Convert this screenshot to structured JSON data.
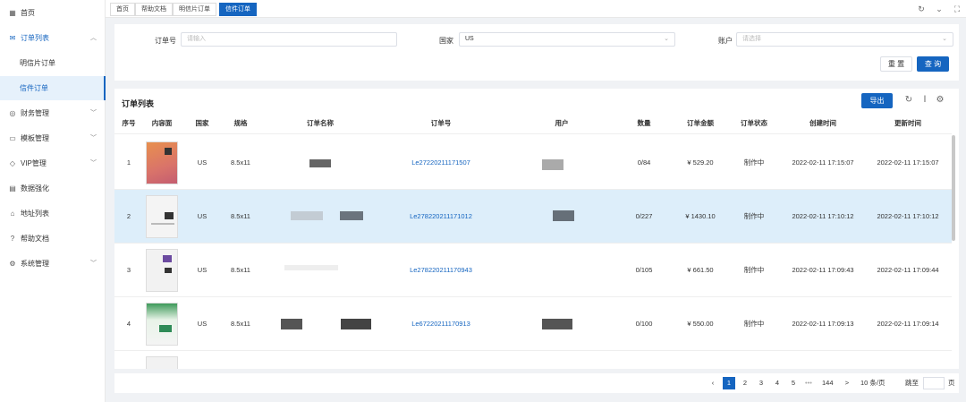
{
  "sidebar": {
    "items": [
      {
        "label": "首页",
        "icon": "grid-icon"
      },
      {
        "label": "订单列表",
        "icon": "mail-icon",
        "expanded": true
      },
      {
        "label": "明信片订单",
        "sub": true
      },
      {
        "label": "信件订单",
        "sub": true,
        "selected": true
      },
      {
        "label": "财务管理",
        "icon": "finance-icon",
        "expanded": false
      },
      {
        "label": "模板管理",
        "icon": "template-icon",
        "expanded": false
      },
      {
        "label": "VIP管理",
        "icon": "vip-icon",
        "expanded": false
      },
      {
        "label": "数据强化",
        "icon": "data-icon"
      },
      {
        "label": "地址列表",
        "icon": "address-icon"
      },
      {
        "label": "帮助文档",
        "icon": "help-icon"
      },
      {
        "label": "系统管理",
        "icon": "gear-icon",
        "expanded": false
      }
    ]
  },
  "tabs": [
    {
      "label": "首页"
    },
    {
      "label": "帮助文档"
    },
    {
      "label": "明信片订单"
    },
    {
      "label": "信件订单",
      "active": true
    }
  ],
  "filter": {
    "order_no_label": "订单号",
    "order_no_placeholder": "请输入",
    "country_label": "国家",
    "country_value": "US",
    "account_label": "账户",
    "account_placeholder": "请选择",
    "reset_label": "重 置",
    "search_label": "查 询"
  },
  "table": {
    "title": "订单列表",
    "export_label": "导出",
    "columns": [
      "序号",
      "内容面",
      "国家",
      "规格",
      "订单名称",
      "订单号",
      "用户",
      "数量",
      "订单金额",
      "订单状态",
      "创建时间",
      "更新时间"
    ],
    "rows": [
      {
        "index": "1",
        "country": "US",
        "size": "8.5x11",
        "order_no": "Le27220211171507",
        "qty": "0/84",
        "amount": "¥ 529.20",
        "status": "制作中",
        "created": "2022-02-11 17:15:07",
        "updated": "2022-02-11 17:15:07"
      },
      {
        "index": "2",
        "country": "US",
        "size": "8.5x11",
        "order_no": "Le278220211171012",
        "qty": "0/227",
        "amount": "¥ 1430.10",
        "status": "制作中",
        "created": "2022-02-11 17:10:12",
        "updated": "2022-02-11 17:10:12"
      },
      {
        "index": "3",
        "country": "US",
        "size": "8.5x11",
        "order_no": "Le278220211170943",
        "qty": "0/105",
        "amount": "¥ 661.50",
        "status": "制作中",
        "created": "2022-02-11 17:09:43",
        "updated": "2022-02-11 17:09:44"
      },
      {
        "index": "4",
        "country": "US",
        "size": "8.5x11",
        "order_no": "Le67220211170913",
        "qty": "0/100",
        "amount": "¥ 550.00",
        "status": "制作中",
        "created": "2022-02-11 17:09:13",
        "updated": "2022-02-11 17:09:14"
      }
    ]
  },
  "pager": {
    "pages": [
      "1",
      "2",
      "3",
      "4",
      "5"
    ],
    "ellipsis": "•••",
    "last_page": "144",
    "prev": "‹",
    "next": ">",
    "page_size": "10 条/页",
    "goto_label": "跳至",
    "page_suffix": "页"
  }
}
